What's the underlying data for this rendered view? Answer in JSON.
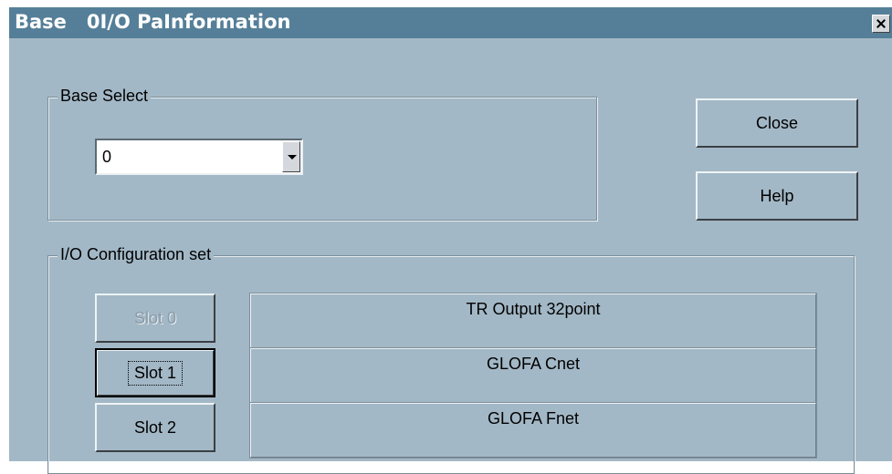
{
  "window": {
    "title": "Base   0I/O PaInformation",
    "close_icon": "close-icon"
  },
  "base_select": {
    "legend": "Base Select",
    "value": "0"
  },
  "buttons": {
    "close": "Close",
    "help": "Help"
  },
  "io_config": {
    "legend": "I/O Configuration set",
    "slots": [
      {
        "label": "Slot 0",
        "module": "TR Output 32point",
        "state": "disabled"
      },
      {
        "label": "Slot 1",
        "module": "GLOFA Cnet",
        "state": "focused"
      },
      {
        "label": "Slot 2",
        "module": "GLOFA Fnet",
        "state": "normal"
      }
    ]
  }
}
